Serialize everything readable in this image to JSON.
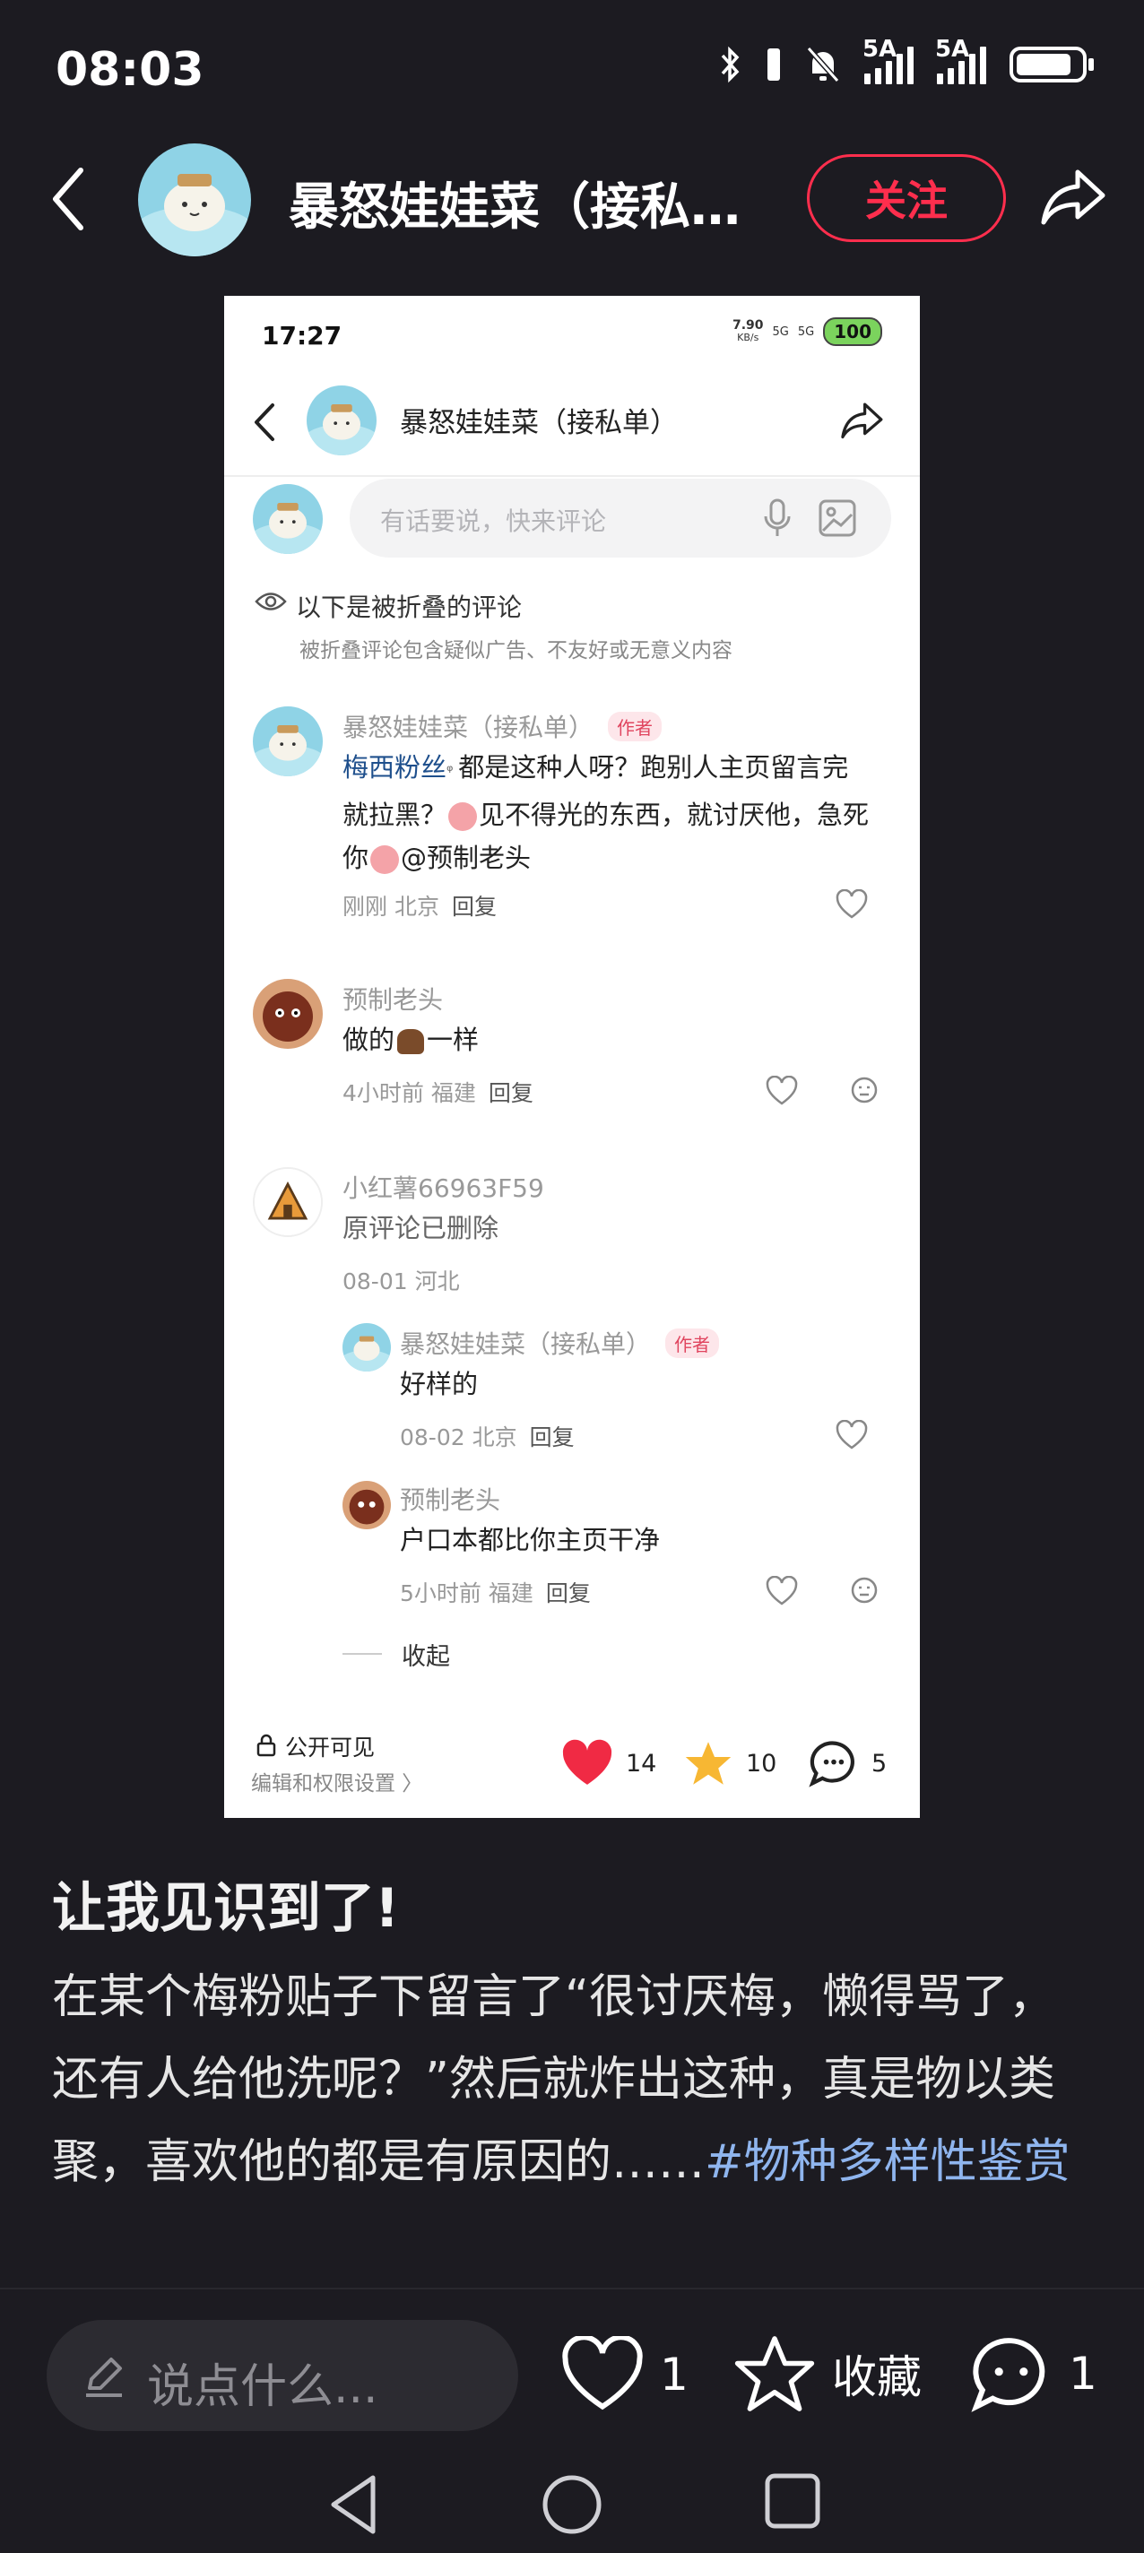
{
  "status_bar": {
    "time": "08:03",
    "network1": "5A",
    "network2": "5A"
  },
  "header": {
    "title": "暴怒娃娃菜（接私…",
    "follow_label": "关注"
  },
  "screenshot": {
    "time": "17:27",
    "speed_value": "7.90",
    "speed_unit": "KB/s",
    "net_a": "5G",
    "net_b": "5G",
    "battery": "100",
    "title": "暴怒娃娃菜（接私单）",
    "input_placeholder": "有话要说，快来评论",
    "folded_title": "以下是被折叠的评论",
    "folded_subtitle": "被折叠评论包含疑似广告、不友好或无意义内容",
    "comments": [
      {
        "name": "暴怒娃娃菜（接私单）",
        "badge": "作者",
        "mention": "梅西粉丝",
        "line1_rest": "都是这种人呀？跑别人主页留言完",
        "line2": "就拉黑？",
        "line2_rest": "见不得光的东西，就讨厌他，急死",
        "line3": "你",
        "line3_rest": "@预制老头",
        "time": "刚刚",
        "location": "北京",
        "reply": "回复"
      },
      {
        "name": "预制老头",
        "text_a": "做的",
        "text_b": "一样",
        "time": "4小时前",
        "location": "福建",
        "reply": "回复"
      },
      {
        "name": "小红薯66963F59",
        "text": "原评论已删除",
        "time": "08-01",
        "location": "河北"
      }
    ],
    "replies": [
      {
        "name": "暴怒娃娃菜（接私单）",
        "badge": "作者",
        "text": "好样的",
        "time": "08-02",
        "location": "北京",
        "reply": "回复"
      },
      {
        "name": "预制老头",
        "text": "户口本都比你主页干净",
        "time": "5小时前",
        "location": "福建",
        "reply": "回复"
      }
    ],
    "collapse_label": "收起",
    "visibility": "公开可见",
    "edit_permissions": "编辑和权限设置 〉",
    "likes": "14",
    "stars": "10",
    "comments_count": "5"
  },
  "post": {
    "title": "让我见识到了!",
    "body": "在某个梅粉贴子下留言了“很讨厌梅，懒得骂了，还有人给他洗呢？”然后就炸出这种，真是物以类聚，喜欢他的都是有原因的……",
    "hashtag": "#物种多样性鉴赏"
  },
  "bottom_bar": {
    "input_placeholder": "说点什么...",
    "likes": "1",
    "collect_label": "收藏",
    "comments": "1"
  },
  "colors": {
    "background": "#1c1b21",
    "accent": "#ff2e4d",
    "hashtag": "#8fb5ee"
  }
}
